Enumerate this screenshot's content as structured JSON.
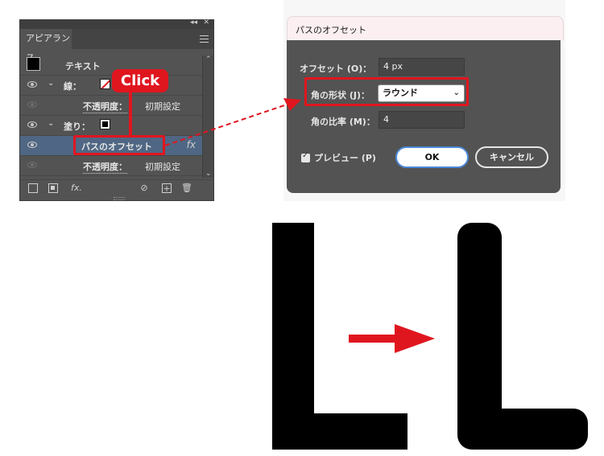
{
  "panel": {
    "tab_label": "アピアランス",
    "rows": {
      "text_label": "テキスト",
      "stroke_label": "線：",
      "stroke_opacity_label": "不透明度：",
      "stroke_opacity_value": "初期設定",
      "fill_label": "塗り：",
      "effect_label": "パスのオフセット",
      "fill_opacity_label": "不透明度：",
      "fill_opacity_value": "初期設定"
    },
    "icons": [
      "eye-icon",
      "chevron-down-icon",
      "fx-icon",
      "new-stroke-icon",
      "new-fill-icon",
      "clear-icon",
      "duplicate-icon",
      "trash-icon"
    ]
  },
  "callout": {
    "click_label": "Click"
  },
  "dialog": {
    "title": "パスのオフセット",
    "offset_label": "オフセット (O)：",
    "offset_value": "4 px",
    "corner_label": "角の形状 (J)：",
    "corner_value": "ラウンド",
    "miter_label": "角の比率 (M)：",
    "miter_value": "4",
    "preview_label": "プレビュー (P)",
    "preview_checked": true,
    "ok_label": "OK",
    "cancel_label": "キャンセル"
  },
  "colors": {
    "highlight": "#e0161f",
    "panel_bg": "#535353",
    "selected_row": "#4f6784",
    "ok_border": "#4b89d8"
  }
}
